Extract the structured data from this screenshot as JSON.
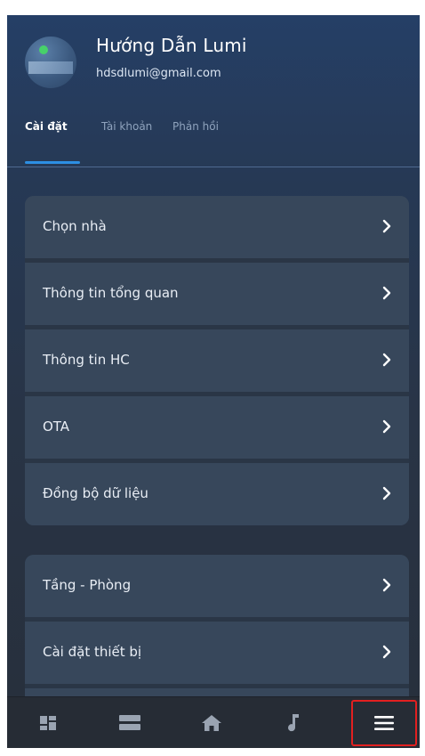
{
  "user": {
    "name": "Hướng Dẫn Lumi",
    "email": "hdsdlumi@gmail.com"
  },
  "tabs": [
    {
      "label": "Cài đặt",
      "active": true
    },
    {
      "label": "Tài khoản",
      "active": false
    },
    {
      "label": "Phản hồi",
      "active": false
    }
  ],
  "settings_group_1": [
    {
      "label": "Chọn nhà"
    },
    {
      "label": "Thông tin tổng quan"
    },
    {
      "label": "Thông tin HC"
    },
    {
      "label": "OTA"
    },
    {
      "label": "Đồng bộ dữ liệu"
    }
  ],
  "settings_group_2": [
    {
      "label": "Tầng - Phòng"
    },
    {
      "label": "Cài đặt thiết bị"
    }
  ],
  "bottom_nav": [
    {
      "icon": "dashboard-icon"
    },
    {
      "icon": "list-icon"
    },
    {
      "icon": "home-icon"
    },
    {
      "icon": "music-icon"
    },
    {
      "icon": "menu-icon",
      "selected": true
    }
  ],
  "colors": {
    "accent": "#2d8fe3",
    "highlight_border": "#e22020",
    "card": "#37475b",
    "nav_bg": "#262c35"
  }
}
